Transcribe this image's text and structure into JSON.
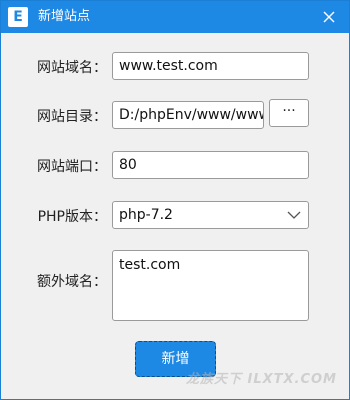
{
  "window": {
    "title": "新增站点",
    "app_icon_letter": "E",
    "accent_color": "#1e88e5"
  },
  "form": {
    "domain_label": "网站域名：",
    "domain_value": "www.test.com",
    "dir_label": "网站目录：",
    "dir_value": "D:/phpEnv/www/www.test.com",
    "browse_label": "···",
    "port_label": "网站端口：",
    "port_value": "80",
    "php_label": "PHP版本：",
    "php_value": "php-7.2",
    "extra_label": "额外域名：",
    "extra_value": "test.com"
  },
  "actions": {
    "submit_label": "新增"
  },
  "watermark": {
    "text": "龙族天下 ILXTX.COM"
  }
}
